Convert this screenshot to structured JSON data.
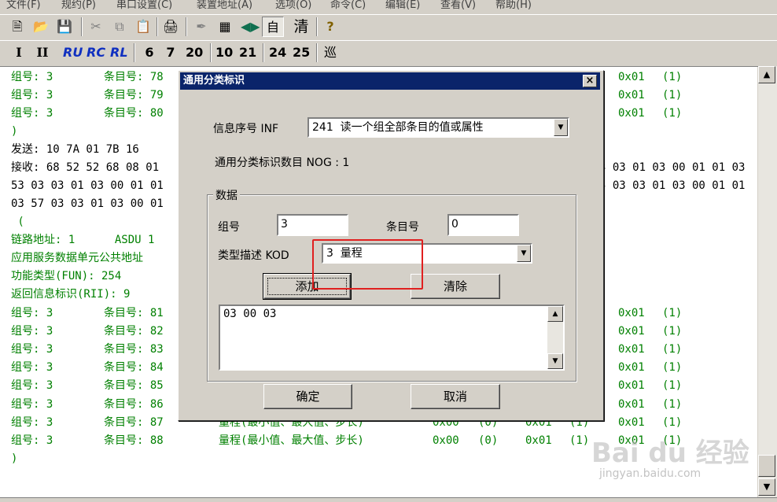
{
  "menu": [
    "文件(F)",
    "规约(P)",
    "串口设置(C)",
    "装置地址(A)",
    "选项(O)",
    "命令(C)",
    "编辑(E)",
    "查看(V)",
    "帮助(H)"
  ],
  "toolbar2": [
    "I",
    "II",
    "RU",
    "RC",
    "RL",
    "6",
    "7",
    "20",
    "10",
    "21",
    "24",
    "25",
    "巡"
  ],
  "toolbar1_text": {
    "auto": "自",
    "clear": "清",
    "help": "?"
  },
  "log": {
    "top_rows": [
      {
        "g": "组号: 3",
        "e": "条目号: 78",
        "v": "0x01",
        "p": "(1)"
      },
      {
        "g": "组号: 3",
        "e": "条目号: 79",
        "v": "0x01",
        "p": "(1)"
      },
      {
        "g": "组号: 3",
        "e": "条目号: 80",
        "v": "0x01",
        "p": "(1)"
      }
    ],
    "close1": ")",
    "send": "发送: 10 7A 01 7B 16",
    "recv": "接收: 68 52 52 68 08 01",
    "recv_tail": "3 03 01 03 00 01 01 03",
    "line2": "53 03 03 01 03 00 01 01",
    "line2_tail": "5 03 03 01 03 00 01 01",
    "line3": "03 57 03 03 01 03 00 01",
    "open_paren": " (",
    "link_addr": "链路地址: 1      ASDU 1",
    "asdu_addr": "应用服务数据单元公共地址",
    "fun": "功能类型(FUN): 254",
    "rii": "返回信息标识(RII): 9",
    "mid_rows": [
      {
        "g": "组号: 3",
        "e": "条目号: 81",
        "v": "0x01",
        "p": "(1)"
      },
      {
        "g": "组号: 3",
        "e": "条目号: 82",
        "v": "0x01",
        "p": "(1)"
      },
      {
        "g": "组号: 3",
        "e": "条目号: 83",
        "v": "0x01",
        "p": "(1)"
      },
      {
        "g": "组号: 3",
        "e": "条目号: 84",
        "v": "0x01",
        "p": "(1)"
      },
      {
        "g": "组号: 3",
        "e": "条目号: 85",
        "v": "0x01",
        "p": "(1)"
      },
      {
        "g": "组号: 3",
        "e": "条目号: 86",
        "v": "0x01",
        "p": "(1)"
      }
    ],
    "full_rows": [
      {
        "g": "组号: 3",
        "e": "条目号: 87",
        "desc": "量程(最小值、最大值、步长)",
        "a": "0x00",
        "b": "(0)",
        "c": "0x01",
        "d": "(1)",
        "v": "0x01",
        "p": "(1)"
      },
      {
        "g": "组号: 3",
        "e": "条目号: 88",
        "desc": "量程(最小值、最大值、步长)",
        "a": "0x00",
        "b": "(0)",
        "c": "0x01",
        "d": "(1)",
        "v": "0x01",
        "p": "(1)"
      }
    ],
    "close2": ")"
  },
  "dialog": {
    "title": "通用分类标识",
    "close": "×",
    "inf_label": "信息序号 INF",
    "inf_value": "241  读一个组全部条目的值或属性",
    "nog_label": "通用分类标识数目  NOG :  1",
    "group_title": "数据",
    "group_label": "组号",
    "group_value": "3",
    "entry_label": "条目号",
    "entry_value": "0",
    "kod_label": "类型描述  KOD",
    "kod_value": "3  量程",
    "add_button": "添加",
    "clear_button": "清除",
    "memo_text": "03 00 03",
    "ok_button": "确定",
    "cancel_button": "取消"
  },
  "watermark": {
    "brand": "Bai du 经验",
    "url": "jingyan.baidu.com"
  },
  "colors": {
    "log_text": "#008000",
    "title_bar": "#0a246a",
    "highlight": "#e02020"
  }
}
